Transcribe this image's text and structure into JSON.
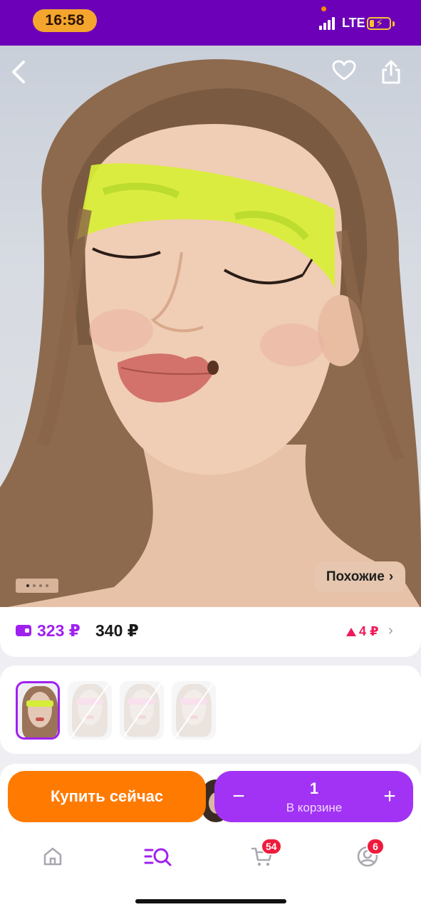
{
  "status_bar": {
    "time": "16:58",
    "network": "LTE"
  },
  "hero": {
    "pager": {
      "count": 4,
      "active_index": 0
    },
    "similar_label": "Похожие",
    "icons": [
      "back-arrow-icon",
      "heart-icon",
      "share-icon"
    ]
  },
  "price": {
    "wallet_price": "323 ₽",
    "regular_price": "340 ₽",
    "price_change": "4 ₽",
    "wallet_color": "#a020f0",
    "change_color": "#ef1b5a"
  },
  "thumbnails": {
    "count": 4,
    "selected_index": 0
  },
  "actions": {
    "buy_now_label": "Купить сейчас",
    "cart_quantity": "1",
    "in_cart_label": "В корзине",
    "buy_color": "#ff7a00",
    "cart_color": "#a233f5"
  },
  "bottom_nav": {
    "items": [
      {
        "name": "home",
        "icon": "home-icon"
      },
      {
        "name": "catalog",
        "icon": "catalog-search-icon"
      },
      {
        "name": "cart",
        "icon": "cart-icon",
        "badge": "54"
      },
      {
        "name": "profile",
        "icon": "profile-icon",
        "badge": "6"
      }
    ]
  }
}
